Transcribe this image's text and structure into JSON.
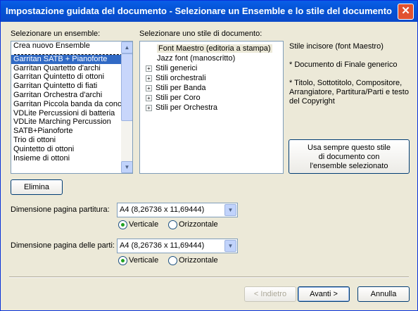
{
  "window": {
    "title": "Impostazione guidata del documento - Selezionare un Ensemble e lo stile del documento",
    "close_glyph": "✕"
  },
  "ensemble": {
    "label": "Selezionare un ensemble:",
    "items": [
      "Crea nuovo Ensemble",
      "Garritan SATB + Pianoforte",
      "Garritan Quartetto d'archi",
      "Garritan Quintetto di ottoni",
      "Garritan Quintetto di fiati",
      "Garritan Orchestra d'archi",
      "Garritan Piccola banda da conc",
      "VDLite Percussioni di batteria",
      "VDLite Marching Percussion",
      "SATB+Pianoforte",
      "Trio di ottoni",
      "Quintetto di ottoni",
      "Insieme di ottoni"
    ],
    "selected": "Garritan SATB + Pianoforte"
  },
  "style": {
    "label": "Selezionare uno stile di documento:",
    "items": [
      {
        "label": "Font Maestro (editoria a stampa)",
        "expandable": false,
        "selected": true
      },
      {
        "label": "Jazz font (manoscritto)",
        "expandable": false,
        "selected": false
      },
      {
        "label": "Stili generici",
        "expandable": true,
        "selected": false
      },
      {
        "label": "Stili orchestrali",
        "expandable": true,
        "selected": false
      },
      {
        "label": "Stili per Banda",
        "expandable": true,
        "selected": false
      },
      {
        "label": "Stili per Coro",
        "expandable": true,
        "selected": false
      },
      {
        "label": "Stili per Orchestra",
        "expandable": true,
        "selected": false
      }
    ]
  },
  "info": {
    "line1": "Stile incisore (font Maestro)",
    "line2": "* Documento di Finale generico",
    "line3a": "* Titolo, Sottotitolo, Compositore,",
    "line3b": "Arrangiatore, Partitura/Parti e testo",
    "line3c": "del Copyright"
  },
  "use_always_button": {
    "line1": "Usa sempre questo stile",
    "line2": "di documento con",
    "line3": "l'ensemble selezionato"
  },
  "delete_button": "Elimina",
  "score_page": {
    "label": "Dimensione pagina partitura:",
    "value": "A4 (8,26736 x 11,69444)",
    "radio_vertical": "Verticale",
    "radio_horizontal": "Orizzontale",
    "orientation": "Verticale"
  },
  "parts_page": {
    "label": "Dimensione pagina delle parti:",
    "value": "A4 (8,26736 x 11,69444)",
    "radio_vertical": "Verticale",
    "radio_horizontal": "Orizzontale",
    "orientation": "Verticale"
  },
  "footer": {
    "back": "< Indietro",
    "next": "Avanti >",
    "cancel": "Annulla"
  },
  "colors": {
    "titlebar": "#0a5ee8",
    "selection": "#316ac5",
    "radio_dot": "#21a121",
    "disabled_text": "#aca899"
  }
}
